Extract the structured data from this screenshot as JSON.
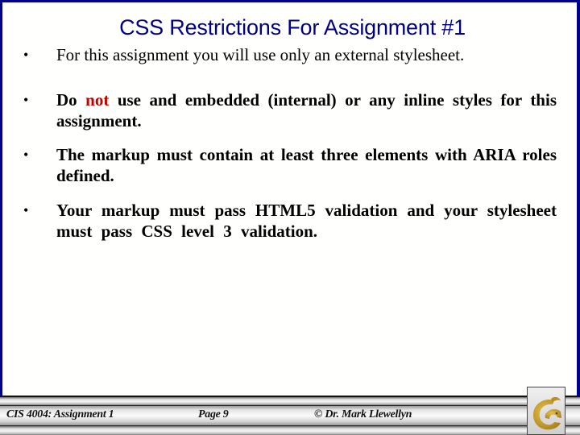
{
  "slide": {
    "title": "CSS Restrictions For Assignment #1",
    "bullets": [
      {
        "bullet_char": "•",
        "text": "For this assignment you will use only an external stylesheet.",
        "bold": false
      },
      {
        "bullet_char": "•",
        "text_before": "Do ",
        "highlight": "not",
        "text_after": " use and embedded (internal) or any inline styles for this assignment.",
        "bold": true,
        "highlight_color": "#c00000"
      },
      {
        "bullet_char": "•",
        "text": "The markup must contain at least three elements with ARIA roles defined.",
        "bold": true
      },
      {
        "bullet_char": "•",
        "text": "Your markup must pass HTML5 validation and your stylesheet must pass CSS level 3 validation.",
        "bold": true
      }
    ]
  },
  "footer": {
    "course": "CIS 4004:  Assignment 1",
    "page": "Page 9",
    "author": "© Dr. Mark Llewellyn",
    "logo_icon": "pegasus-logo-icon"
  },
  "colors": {
    "title": "#000080",
    "border": "#00008b",
    "highlight": "#c00000",
    "logo_gold": "#c9a227"
  }
}
